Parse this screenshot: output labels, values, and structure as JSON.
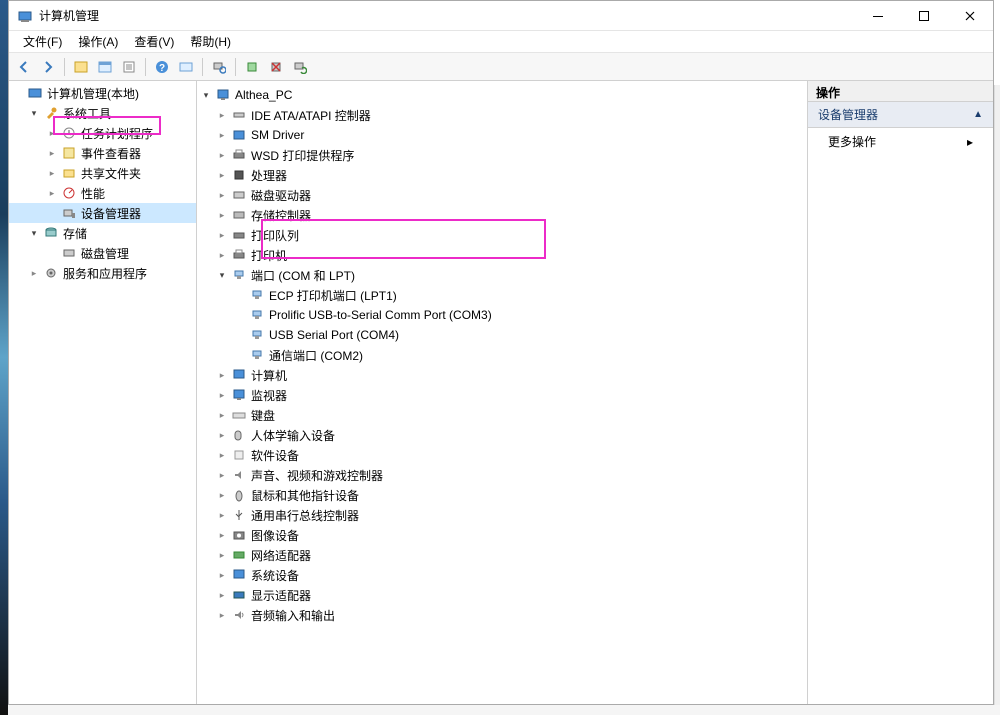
{
  "window": {
    "title": "计算机管理"
  },
  "menu": {
    "file": "文件(F)",
    "action": "操作(A)",
    "view": "查看(V)",
    "help": "帮助(H)"
  },
  "nav": {
    "root": "计算机管理(本地)",
    "system_tools": "系统工具",
    "task_scheduler": "任务计划程序",
    "event_viewer": "事件查看器",
    "shared_folders": "共享文件夹",
    "performance": "性能",
    "device_manager": "设备管理器",
    "storage": "存储",
    "disk_management": "磁盘管理",
    "services_apps": "服务和应用程序"
  },
  "device": {
    "root": "Althea_PC",
    "ide_atapi": "IDE ATA/ATAPI 控制器",
    "sm_driver": "SM Driver",
    "wsd_print": "WSD 打印提供程序",
    "processors": "处理器",
    "disk_drives": "磁盘驱动器",
    "storage_controllers": "存储控制器",
    "print_queues": "打印队列",
    "printers": "打印机",
    "ports": "端口 (COM 和 LPT)",
    "port_ecp": "ECP 打印机端口 (LPT1)",
    "port_prolific": "Prolific USB-to-Serial Comm Port (COM3)",
    "port_usb_serial": "USB Serial Port (COM4)",
    "port_comm": "通信端口 (COM2)",
    "computer": "计算机",
    "monitors": "监视器",
    "keyboards": "键盘",
    "hid": "人体学输入设备",
    "software_devices": "软件设备",
    "sound_video_game": "声音、视频和游戏控制器",
    "mice": "鼠标和其他指针设备",
    "usb_controllers": "通用串行总线控制器",
    "imaging": "图像设备",
    "network_adapters": "网络适配器",
    "system_devices": "系统设备",
    "display_adapters": "显示适配器",
    "audio_io": "音频输入和输出"
  },
  "actions": {
    "header": "操作",
    "section": "设备管理器",
    "more": "更多操作"
  }
}
